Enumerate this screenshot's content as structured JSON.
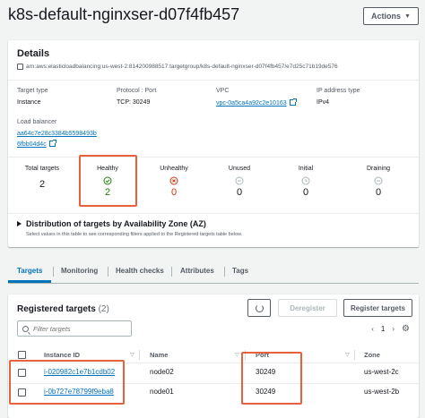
{
  "header": {
    "title": "k8s-default-nginxser-d07f4fb457",
    "actions_label": "Actions"
  },
  "details": {
    "title": "Details",
    "arn": "arn:aws:elasticloadbalancing:us-west-2:814200988517:targetgroup/k8s-default-nginxser-d07f4fb457/e7d25c71b19de576",
    "target_type": {
      "label": "Target type",
      "value": "Instance"
    },
    "protocol_port": {
      "label": "Protocol : Port",
      "value": "TCP: 30249"
    },
    "vpc": {
      "label": "VPC",
      "value": "vpc-0a5ca4a92c2e10163"
    },
    "ip_type": {
      "label": "IP address type",
      "value": "IPv4"
    },
    "load_balancer": {
      "label": "Load balancer",
      "line1": "aa64c7e28c3384b5598493b",
      "line2": "6fbb04d4c"
    }
  },
  "stats": [
    {
      "label": "Total targets",
      "value": "2",
      "icon": "none",
      "color": "#16191f"
    },
    {
      "label": "Healthy",
      "value": "2",
      "icon": "check-circle-icon",
      "color": "#1d8102"
    },
    {
      "label": "Unhealthy",
      "value": "0",
      "icon": "x-circle-icon",
      "color": "#d13212"
    },
    {
      "label": "Unused",
      "value": "0",
      "icon": "minus-circle-icon",
      "color": "#16191f"
    },
    {
      "label": "Initial",
      "value": "0",
      "icon": "clock-icon",
      "color": "#16191f"
    },
    {
      "label": "Draining",
      "value": "0",
      "icon": "minus-circle-icon",
      "color": "#16191f"
    }
  ],
  "az": {
    "title": "Distribution of targets by Availability Zone (AZ)",
    "description": "Select values in this table to see corresponding filters applied to the Registered targets table below."
  },
  "tabs": [
    "Targets",
    "Monitoring",
    "Health checks",
    "Attributes",
    "Tags"
  ],
  "registered": {
    "title": "Registered targets",
    "count": "(2)",
    "deregister_label": "Deregister",
    "register_label": "Register targets",
    "filter_placeholder": "Filter targets",
    "page": "1",
    "columns": [
      "Instance ID",
      "Name",
      "Port",
      "Zone"
    ],
    "rows": [
      {
        "instance_id": "i-020982c1e7b1cdb02",
        "name": "node02",
        "port": "30249",
        "zone": "us-west-2c"
      },
      {
        "instance_id": "i-0b727e78799f9eba8",
        "name": "node01",
        "port": "30249",
        "zone": "us-west-2b"
      }
    ]
  },
  "colors": {
    "link": "#0073bb",
    "healthy": "#1d8102",
    "unhealthy": "#d13212",
    "annotation": "#e8603c"
  }
}
